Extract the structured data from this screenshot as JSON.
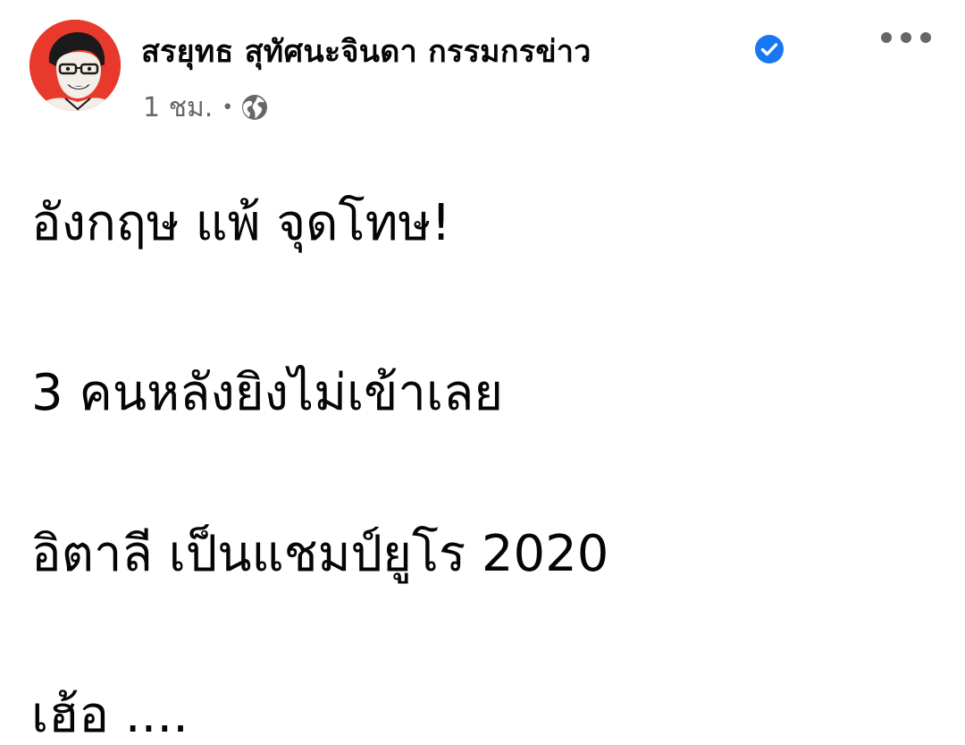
{
  "post": {
    "author": {
      "name": "สรยุทธ สุทัศนะจินดา กรรมกรข่าว",
      "verified": true,
      "avatar_icon": "portrait-avatar"
    },
    "meta": {
      "time": "1 ชม.",
      "separator": "•",
      "audience_icon": "globe-icon"
    },
    "more_icon": "more-horizontal-icon",
    "lines": [
      "อังกฤษ แพ้ จุดโทษ!",
      "3 คนหลังยิงไม่เข้าเลย",
      "อิตาลี เป็นแชมป์ยูโร 2020",
      "เฮ้อ ...."
    ]
  },
  "colors": {
    "text": "#050505",
    "secondary_text": "#65676b",
    "verified_blue": "#1877f2",
    "avatar_bg": "#e8392c"
  }
}
